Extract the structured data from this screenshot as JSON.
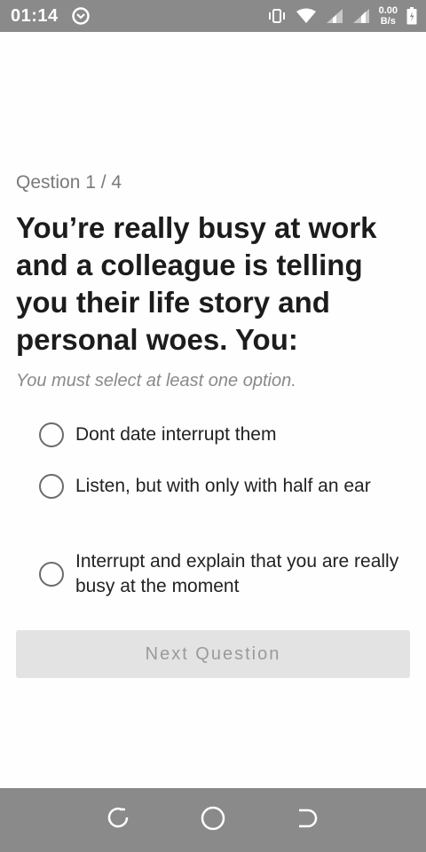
{
  "status_bar": {
    "time": "01:14",
    "net_speed_value": "0.00",
    "net_speed_unit": "B/s",
    "icons": [
      "sync-icon",
      "vibrate-icon",
      "wifi-icon",
      "signal-icon",
      "signal-icon",
      "battery-icon"
    ]
  },
  "quiz": {
    "counter": "Qestion 1 / 4",
    "question": "You’re really busy at work and a colleague is telling you their life story and personal woes. You:",
    "hint": "You must select at least one option.",
    "options": [
      {
        "label": "Dont date interrupt them",
        "selected": false
      },
      {
        "label": "Listen, but with only with half an ear",
        "selected": false
      },
      {
        "label": "Interrupt and explain that you are really busy at the moment",
        "selected": false
      }
    ],
    "next_label": "Next Question"
  },
  "nav_bar": {
    "icons": [
      "back-icon",
      "home-icon",
      "recents-icon"
    ]
  },
  "colors": {
    "bars": "#8a8a8a",
    "question_text": "#1c1c1c",
    "muted_text": "#7a7a7a",
    "button_bg": "#e3e3e3",
    "button_text": "#9a9a9a"
  }
}
